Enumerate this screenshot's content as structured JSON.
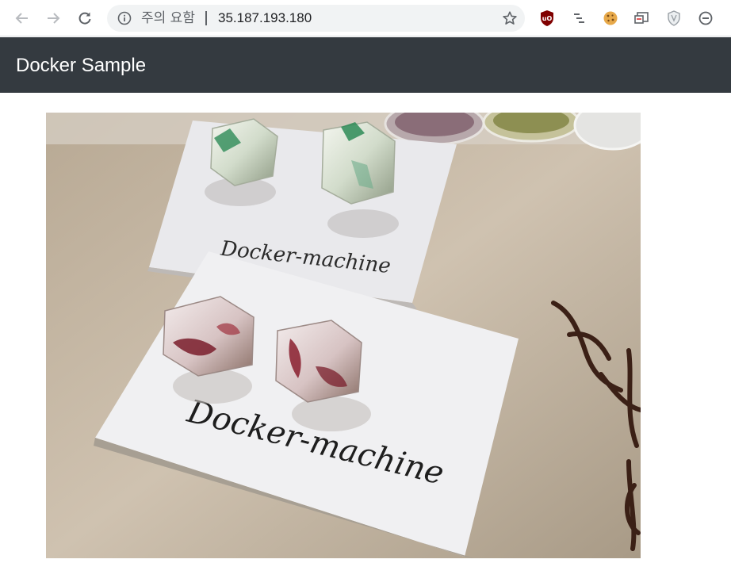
{
  "browser": {
    "security_warning": "주의 요함",
    "url": "35.187.193.180",
    "icons": {
      "back": "back-arrow-icon",
      "forward": "forward-arrow-icon",
      "reload": "reload-icon",
      "info": "info-icon",
      "bookmark": "star-icon"
    },
    "extensions": [
      "ublock-icon",
      "tree-list-icon",
      "cookie-icon",
      "cast-icon",
      "shield-icon",
      "block-icon"
    ]
  },
  "navbar": {
    "brand": "Docker Sample",
    "background": "#343a40"
  },
  "image": {
    "card_back_text": "Docker-machine",
    "card_front_text": "Docker-machine"
  }
}
